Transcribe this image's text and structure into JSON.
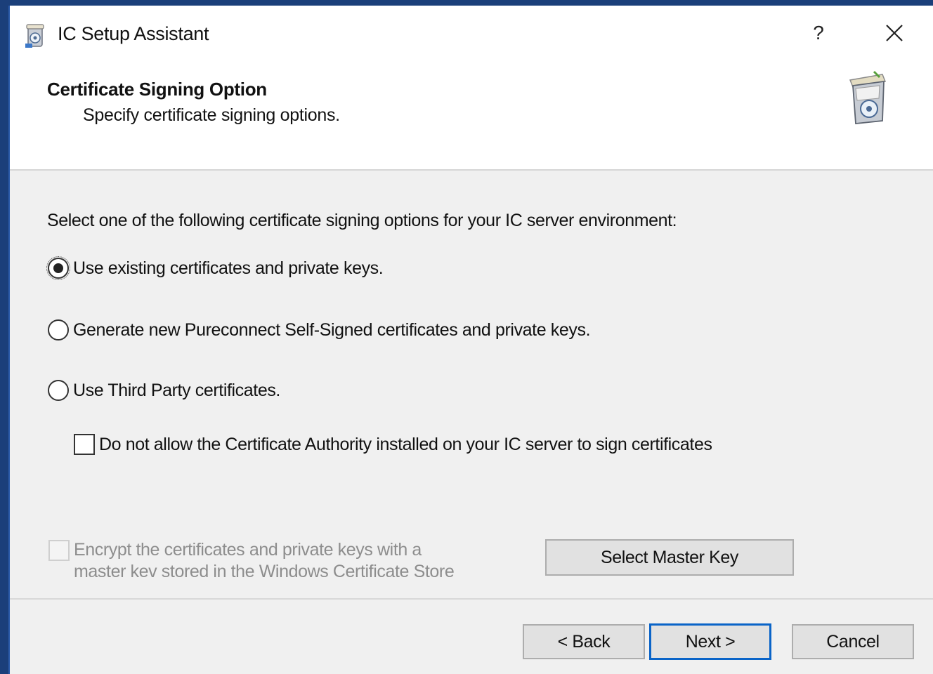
{
  "window": {
    "title": "IC Setup Assistant",
    "help_label": "?"
  },
  "header": {
    "page_title": "Certificate Signing Option",
    "page_subtitle": "Specify certificate signing options."
  },
  "main": {
    "instruction": "Select one of the following certificate signing options for your IC server environment:",
    "options": [
      {
        "label": "Use existing certificates and private keys.",
        "selected": true
      },
      {
        "label": "Generate new Pureconnect Self-Signed certificates and private keys.",
        "selected": false
      },
      {
        "label": "Use Third Party certificates.",
        "selected": false
      }
    ],
    "ca_checkbox": {
      "label": "Do not allow the Certificate Authority installed on your IC server to sign certificates",
      "checked": false
    },
    "encrypt_checkbox": {
      "line1": "Encrypt the certificates and private keys with a",
      "line2": "master kev stored in the Windows Certificate Store",
      "checked": false,
      "enabled": false
    },
    "select_master_key_label": "Select Master Key"
  },
  "footer": {
    "back_label": "< Back",
    "next_label": "Next >",
    "cancel_label": "Cancel"
  }
}
